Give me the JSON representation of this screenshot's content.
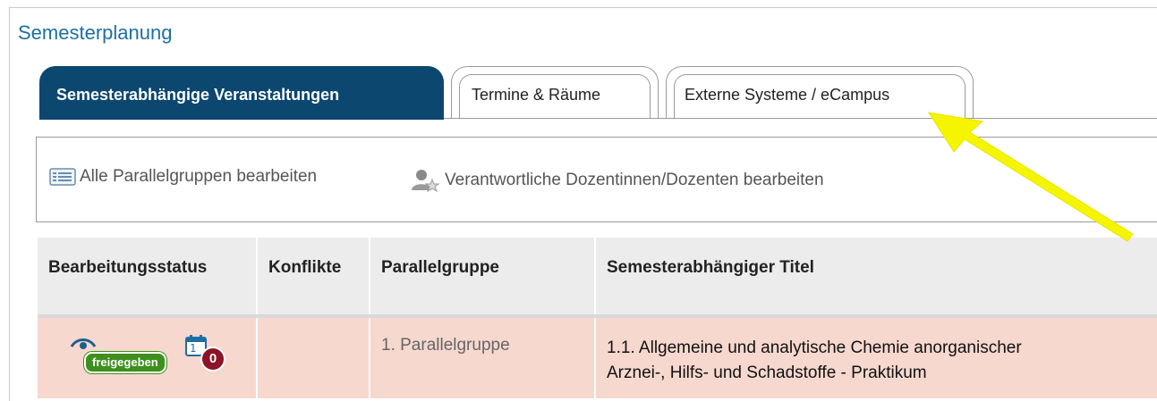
{
  "page": {
    "title": "Semesterplanung"
  },
  "tabs": [
    {
      "label": "Semesterabhängige Veranstaltungen",
      "active": true
    },
    {
      "label": "Termine & Räume",
      "active": false
    },
    {
      "label": "Externe Systeme / eCampus",
      "active": false
    }
  ],
  "toolbar": {
    "edit_all_groups": {
      "label": "Alle Parallelgruppen bearbeiten",
      "icon": "list-icon"
    },
    "edit_lecturers": {
      "label": "Verantwortliche Dozentinnen/Dozenten bearbeiten",
      "icon": "person-star-icon"
    }
  },
  "table": {
    "columns": [
      "Bearbeitungsstatus",
      "Konflikte",
      "Parallelgruppe",
      "Semesterabhängiger Titel"
    ],
    "rows": [
      {
        "status_badge": "freigegeben",
        "calendar_count": "0",
        "calendar_label": "1",
        "konflikte": "",
        "parallelgruppe": "1. Parallelgruppe",
        "title_line1": "1.1. Allgemeine und analytische Chemie anorganischer",
        "title_line2": "Arznei-, Hilfs- und Schadstoffe - Praktikum"
      }
    ]
  },
  "colors": {
    "title_blue": "#1d6fa3",
    "active_tab": "#0c4770",
    "row_bg": "#f6d8cf",
    "badge_green": "#3f8f1e",
    "badge_red": "#8b1428",
    "annotation_arrow": "#f5f500"
  }
}
